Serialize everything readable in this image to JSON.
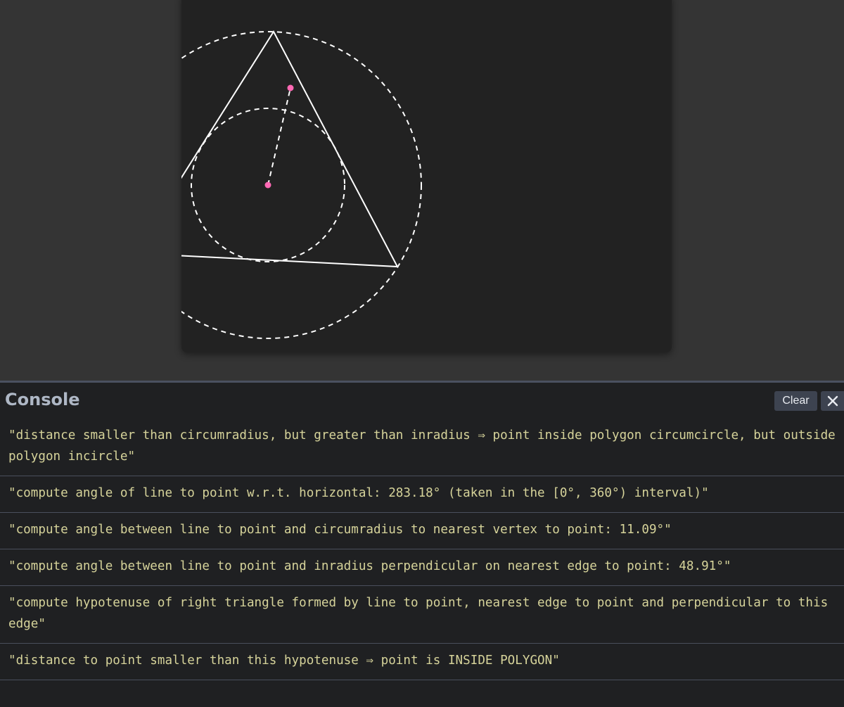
{
  "console": {
    "title": "Console",
    "clear_label": "Clear",
    "close_icon": "close-icon",
    "messages": [
      "\"distance smaller than circumradius, but greater than inradius ⇒ point inside polygon circumcircle, but outside polygon incircle\"",
      "\"compute angle of line to point w.r.t. horizontal: 283.18° (taken in the [0°, 360°) interval)\"",
      "\"compute angle between line to point and circumradius to nearest vertex to point: 11.09°\"",
      "\"compute angle between line to point and inradius perpendicular on nearest edge to point: 48.91°\"",
      "\"compute hypotenuse of right triangle formed by line to point, nearest edge to point and perpendicular to this edge\"",
      "\"distance to point smaller than this hypotenuse ⇒ point is INSIDE POLYGON\""
    ]
  },
  "colors": {
    "background": "#343434",
    "canvas": "#222222",
    "stroke": "#ffffff",
    "point": "#ff69b4",
    "console_bg": "#1f2022",
    "console_text": "#d6d39a",
    "title_text": "#aeb7c5",
    "separator": "#4a4f5c",
    "button_bg": "#3d4350"
  }
}
